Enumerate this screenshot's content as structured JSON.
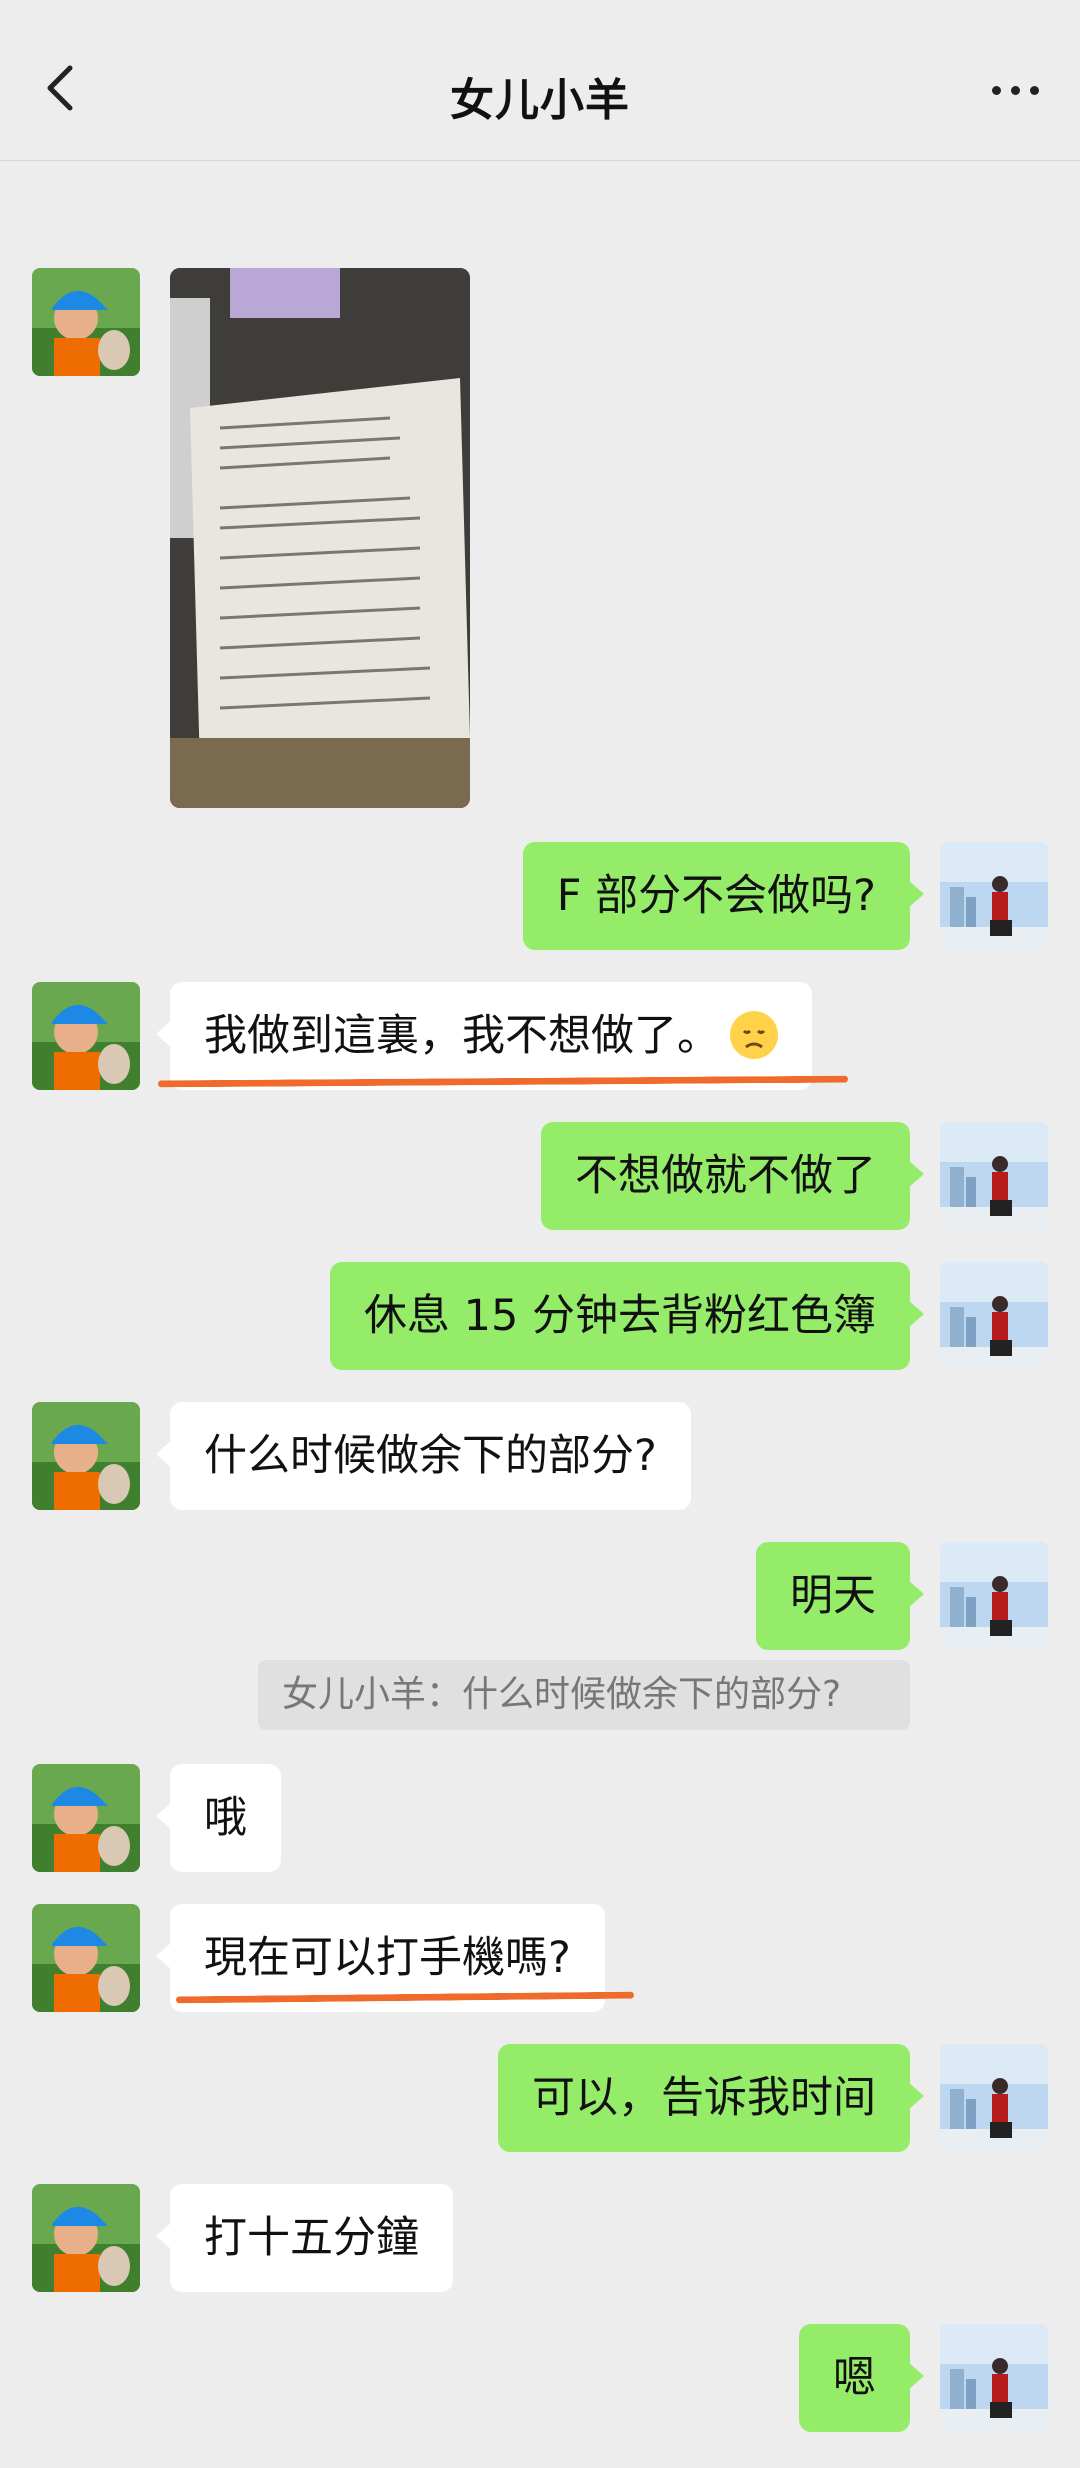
{
  "header": {
    "title": "女儿小羊",
    "back_icon": "chevron-left-icon",
    "more_icon": "more-dots-icon"
  },
  "colors": {
    "self_bubble": "#95ec69",
    "other_bubble": "#ffffff",
    "background": "#ededed",
    "annotation": "#f06a2c"
  },
  "messages": [
    {
      "sender": "other",
      "type": "image",
      "description": "worksheet-photo"
    },
    {
      "sender": "self",
      "text": "F 部分不会做吗?"
    },
    {
      "sender": "other",
      "text": "我做到這裏，我不想做了。",
      "emoji": "disappointed-face-icon",
      "underlined": true
    },
    {
      "sender": "self",
      "text": "不想做就不做了"
    },
    {
      "sender": "self",
      "text": "休息 15 分钟去背粉红色簿"
    },
    {
      "sender": "other",
      "text": "什么时候做余下的部分?"
    },
    {
      "sender": "self",
      "text": "明天"
    },
    {
      "sender": "self",
      "type": "quote",
      "text": "女儿小羊：什么时候做余下的部分?"
    },
    {
      "sender": "other",
      "text": "哦"
    },
    {
      "sender": "other",
      "text": "現在可以打手機嗎?",
      "underlined": true
    },
    {
      "sender": "self",
      "text": "可以，告诉我时间"
    },
    {
      "sender": "other",
      "text": "打十五分鐘"
    },
    {
      "sender": "self",
      "text": "嗯"
    }
  ]
}
